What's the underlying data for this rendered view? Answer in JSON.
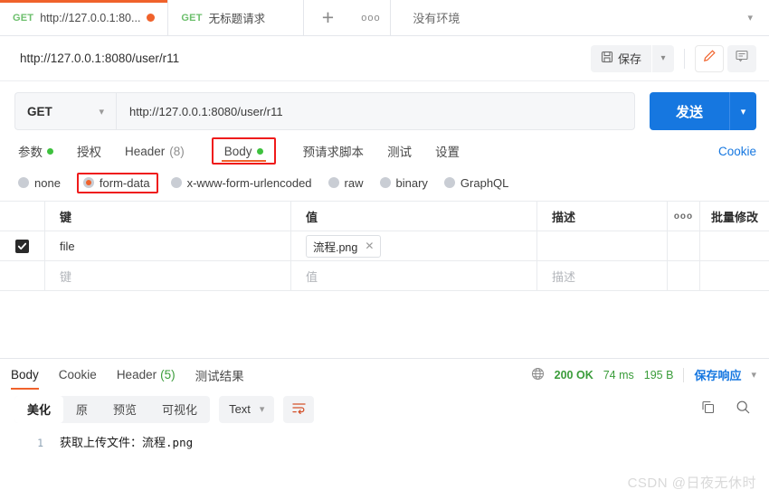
{
  "tabs": [
    {
      "method": "GET",
      "title": "http://127.0.0.1:80...",
      "unsaved": true,
      "active": true
    },
    {
      "method": "GET",
      "title": "无标题请求",
      "unsaved": false,
      "active": false
    }
  ],
  "tabbar": {
    "add_label": "+",
    "more_label": "ooo",
    "environment": "没有环境"
  },
  "title_row": {
    "url_title": "http://127.0.0.1:8080/user/r11",
    "save_label": "保存"
  },
  "request": {
    "method": "GET",
    "url": "http://127.0.0.1:8080/user/r11",
    "send_label": "发送"
  },
  "request_tabs": [
    {
      "label": "参数",
      "dot": true
    },
    {
      "label": "授权",
      "dot": false
    },
    {
      "label": "Header",
      "count": "(8)",
      "dot": false
    },
    {
      "label": "Body",
      "dot": true,
      "active": true,
      "highlight": true
    },
    {
      "label": "预请求脚本",
      "dot": false
    },
    {
      "label": "测试",
      "dot": false
    },
    {
      "label": "设置",
      "dot": false
    }
  ],
  "cookie_link": "Cookie",
  "body_types": [
    {
      "label": "none",
      "checked": false,
      "highlight": false
    },
    {
      "label": "form-data",
      "checked": true,
      "highlight": true
    },
    {
      "label": "x-www-form-urlencoded",
      "checked": false,
      "highlight": false
    },
    {
      "label": "raw",
      "checked": false,
      "highlight": false
    },
    {
      "label": "binary",
      "checked": false,
      "highlight": false
    },
    {
      "label": "GraphQL",
      "checked": false,
      "highlight": false
    }
  ],
  "param_table": {
    "headers": {
      "key": "键",
      "value": "值",
      "description": "描述",
      "more": "ooo",
      "bulk_edit": "批量修改"
    },
    "rows": [
      {
        "checked": true,
        "key": "file",
        "value": "流程.png",
        "value_is_file": true,
        "description": ""
      }
    ],
    "placeholder_row": {
      "key": "键",
      "value": "值",
      "description": "描述"
    }
  },
  "response_tabs": [
    {
      "label": "Body",
      "active": true
    },
    {
      "label": "Cookie",
      "active": false
    },
    {
      "label": "Header",
      "count": "(5)",
      "active": false
    },
    {
      "label": "测试结果",
      "active": false
    }
  ],
  "response_meta": {
    "status": "200 OK",
    "time": "74 ms",
    "size": "195 B",
    "save_response": "保存响应"
  },
  "view_bar": {
    "segments": [
      {
        "label": "美化",
        "active": true
      },
      {
        "label": "原",
        "active": false
      },
      {
        "label": "预览",
        "active": false
      },
      {
        "label": "可视化",
        "active": false
      }
    ],
    "type_select": "Text"
  },
  "response_body": {
    "line_number": "1",
    "text": "获取上传文件：流程",
    "text_mono": ".png"
  },
  "watermark": "CSDN @日夜无休时",
  "colors": {
    "accent_orange": "#f0622b",
    "primary_blue": "#1677e0",
    "success_green": "#3a9c3a",
    "highlight_red": "#ef1b1b"
  }
}
